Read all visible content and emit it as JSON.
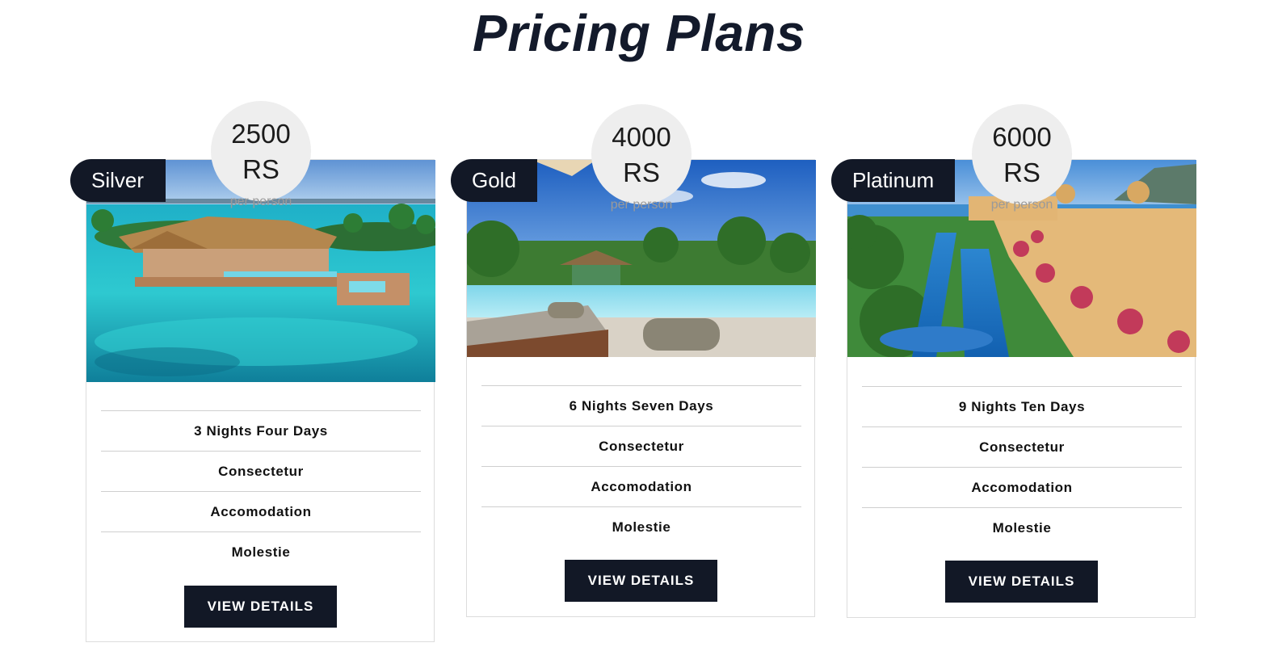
{
  "page": {
    "title": "Pricing Plans"
  },
  "plans": [
    {
      "tier": "Silver",
      "price": "2500",
      "currency": "RS",
      "price_note": "per person",
      "features": [
        "3 Nights Four Days",
        "Consectetur",
        "Accomodation",
        "Molestie"
      ],
      "button_label": "VIEW DETAILS"
    },
    {
      "tier": "Gold",
      "price": "4000",
      "currency": "RS",
      "price_note": "per person",
      "features": [
        "6 Nights Seven Days",
        "Consectetur",
        "Accomodation",
        "Molestie"
      ],
      "button_label": "VIEW DETAILS"
    },
    {
      "tier": "Platinum",
      "price": "6000",
      "currency": "RS",
      "price_note": "per person",
      "features": [
        "9 Nights Ten Days",
        "Consectetur",
        "Accomodation",
        "Molestie"
      ],
      "button_label": "VIEW DETAILS"
    }
  ],
  "colors": {
    "dark": "#121826",
    "circle": "#eeeeee",
    "border": "#dcdcdc"
  }
}
